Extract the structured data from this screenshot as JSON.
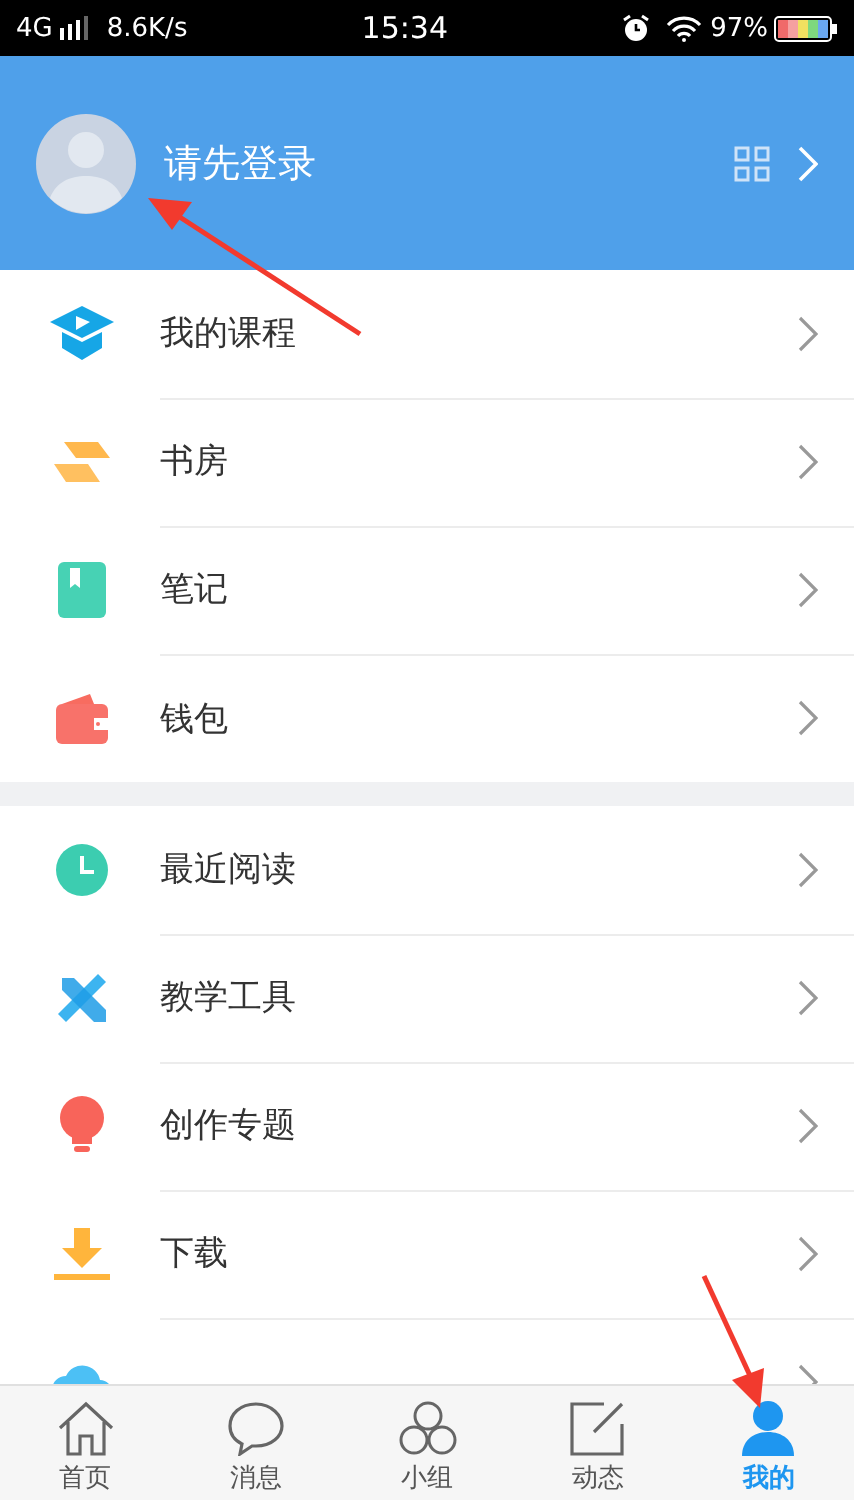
{
  "status_bar": {
    "network": "4G",
    "speed": "8.6K/s",
    "time": "15:34",
    "battery": "97%"
  },
  "header": {
    "login_prompt": "请先登录"
  },
  "sections": [
    {
      "items": [
        {
          "label": "我的课程"
        },
        {
          "label": "书房"
        },
        {
          "label": "笔记"
        },
        {
          "label": "钱包"
        }
      ]
    },
    {
      "items": [
        {
          "label": "最近阅读"
        },
        {
          "label": "教学工具"
        },
        {
          "label": "创作专题"
        },
        {
          "label": "下载"
        }
      ]
    }
  ],
  "tab_bar": [
    {
      "label": "首页",
      "selected": false
    },
    {
      "label": "消息",
      "selected": false
    },
    {
      "label": "小组",
      "selected": false
    },
    {
      "label": "动态",
      "selected": false
    },
    {
      "label": "我的",
      "selected": true
    }
  ]
}
